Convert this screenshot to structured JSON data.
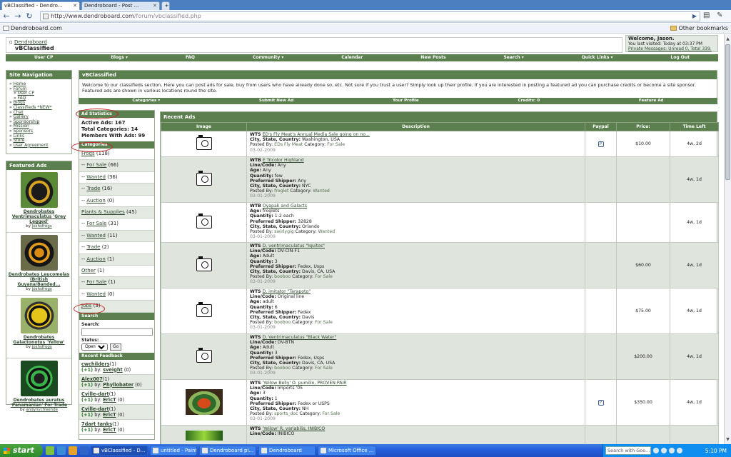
{
  "browser": {
    "tabs": [
      {
        "label": "vBClassified - Dendro...",
        "active": true
      },
      {
        "label": "Dendroboard - Post ...",
        "active": false
      }
    ],
    "url_host": "http://www.dendroboard.com",
    "url_path": "/forum/vbclassified.php",
    "bookmark": "Dendroboard.com",
    "other_bookmarks": "Other bookmarks"
  },
  "page": {
    "breadcrumb_root": "Dendroboard",
    "breadcrumb_current": "vBClassified",
    "welcome": {
      "title": "Welcome, Jason.",
      "last_visited": "You last visited: Today at 03:37 PM",
      "private_messages": "Private Messages: Unread 0, Total 339."
    },
    "navbar": [
      "User CP",
      "Blogs ▾",
      "FAQ",
      "Community ▾",
      "Calendar",
      "New Posts",
      "Search ▾",
      "Quick Links ▾",
      "Log Out"
    ]
  },
  "sidebar": {
    "site_nav_title": "Site Navigation",
    "site_nav_items": [
      {
        "label": "Home",
        "sub": false
      },
      {
        "label": "Forum",
        "sub": false
      },
      {
        "label": "User CP",
        "sub": true
      },
      {
        "label": "FAQ",
        "sub": true
      },
      {
        "label": "Blogs",
        "sub": false
      },
      {
        "label": "Classifieds *NEW*",
        "sub": false
      },
      {
        "label": "Chat",
        "sub": false
      },
      {
        "label": "Gallery",
        "sub": false
      },
      {
        "label": "Sponsorship",
        "sub": false
      },
      {
        "label": "Mission",
        "sub": false
      },
      {
        "label": "Sponsors",
        "sub": false
      },
      {
        "label": "Links",
        "sub": false
      },
      {
        "label": "Store",
        "sub": false
      },
      {
        "label": "User Agreement",
        "sub": false
      }
    ],
    "featured_title": "Featured Ads",
    "featured_ads": [
      {
        "title": "Dendrobates Ventrimaculatus 'Grey Legged'",
        "by": "joshsfrogs"
      },
      {
        "title": "Dendrobates Leucomelas (British Guyana/Banded...",
        "by": "joshsfrogs"
      },
      {
        "title": "Dendrobates Galactonotus 'Yellow'",
        "by": "joshsfrogs"
      },
      {
        "title": "Dendrobates auratus 'Panamanian' For Trade",
        "by": "andynycfreende"
      }
    ]
  },
  "main": {
    "title": "vBClassified",
    "intro": "Welcome to our classifieds section. Here you can post ads for sale, buy from users who have already done so, etc. Not sure if you trust a user? Simply look up their profile. If you are interested in posting a featured ad you can purchase credits or become a site sponsor. Featured ads are shown in various locations round the site.",
    "subnav": [
      "Categories ▾",
      "Submit New Ad",
      "Your Profile",
      "Credits: 0",
      "Feature Ad"
    ]
  },
  "stats": {
    "title": "Ad Statistics",
    "active_ads": "Active Ads: 167",
    "total_categories": "Total Categories: 14",
    "members_with_ads": "Members With Ads: 99"
  },
  "categories": {
    "title": "Categories",
    "items": [
      {
        "prefix": "",
        "label": "Frogs",
        "count": "(118)"
      },
      {
        "prefix": "-- ",
        "label": "For Sale",
        "count": "(66)"
      },
      {
        "prefix": "-- ",
        "label": "Wanted",
        "count": "(36)"
      },
      {
        "prefix": "-- ",
        "label": "Trade",
        "count": "(16)"
      },
      {
        "prefix": "-- ",
        "label": "Auction",
        "count": "(0)"
      },
      {
        "prefix": "",
        "label": "Plants & Supplies",
        "count": "(45)"
      },
      {
        "prefix": "-- ",
        "label": "For Sale",
        "count": "(31)"
      },
      {
        "prefix": "-- ",
        "label": "Wanted",
        "count": "(11)"
      },
      {
        "prefix": "-- ",
        "label": "Trade",
        "count": "(2)"
      },
      {
        "prefix": "-- ",
        "label": "Auction",
        "count": "(1)"
      },
      {
        "prefix": "",
        "label": "Other",
        "count": "(1)"
      },
      {
        "prefix": "-- ",
        "label": "For Sale",
        "count": "(1)"
      },
      {
        "prefix": "-- ",
        "label": "Wanted",
        "count": "(0)"
      },
      {
        "prefix": "",
        "label": "Jobs",
        "count": "(3)"
      }
    ]
  },
  "search": {
    "title": "Search",
    "search_label": "Search:",
    "status_label": "Status:",
    "status_value": "Open",
    "go_label": "Go"
  },
  "feedback": {
    "title": "Recent Feedback",
    "items": [
      {
        "user": "cwchilders",
        "n": "(1)",
        "score": "(+1)",
        "by": "sveight",
        "c": "(0)"
      },
      {
        "user": "Alex007",
        "n": "(1)",
        "score": "(+1)",
        "by": "Phyllobater",
        "c": "(0)"
      },
      {
        "user": "Cville-dart",
        "n": "(1)",
        "score": "(+1)",
        "by": "EricT",
        "c": "(0)"
      },
      {
        "user": "Cville-dart",
        "n": "(1)",
        "score": "(+1)",
        "by": "EricT",
        "c": "(0)"
      },
      {
        "user": "7dart tanks",
        "n": "(1)",
        "score": "(+1)",
        "by": "EricT",
        "c": "(0)"
      }
    ]
  },
  "recent_ads": {
    "title": "Recent Ads",
    "columns": [
      "Image",
      "Description",
      "Paypal",
      "Price:",
      "Time Left"
    ],
    "rows": [
      {
        "image": "camera",
        "type": "WTS",
        "title": "ED's Fly Meat's Annual Media Sale going on no...",
        "fields": [
          [
            "City, State, Country:",
            "Washington, USA"
          ]
        ],
        "posted_by": "EDs Fly Meat",
        "category": "For Sale",
        "date": "03-02-2009",
        "paypal": true,
        "price": "$10.00",
        "time_left": "4w, 2d"
      },
      {
        "image": "camera",
        "type": "WTB",
        "title": "E Tricolor Highland",
        "fields": [
          [
            "Line/Code:",
            "Any"
          ],
          [
            "Age:",
            "Any"
          ],
          [
            "Quantity:",
            "few"
          ],
          [
            "Preferred Shipper:",
            "Any"
          ],
          [
            "City, State, Country:",
            "NYC"
          ]
        ],
        "posted_by": "froglet",
        "category": "Wanted",
        "date": "03-01-2009",
        "paypal": false,
        "price": "",
        "time_left": "4w, 1d"
      },
      {
        "image": "camera",
        "type": "WTB",
        "title": "Oyapak and Galacts",
        "fields": [
          [
            "Age:",
            "froglets"
          ],
          [
            "Quantity:",
            "1-2 each"
          ],
          [
            "Preferred Shipper:",
            "32828"
          ],
          [
            "City, State, Country:",
            "Orlando"
          ]
        ],
        "posted_by": "swirlygig",
        "category": "Wanted",
        "date": "03-01-2009",
        "paypal": false,
        "price": "",
        "time_left": "4w, 1d"
      },
      {
        "image": "camera",
        "type": "WTS",
        "title": "D. ventrimaculatus \"Iquitos\"",
        "fields": [
          [
            "Line/Code:",
            "DV-CIN-F1"
          ],
          [
            "Age:",
            "Adult"
          ],
          [
            "Quantity:",
            "3"
          ],
          [
            "Preferred Shipper:",
            "Fedex, Usps"
          ],
          [
            "City, State, Country:",
            "Davis, CA, USA"
          ]
        ],
        "posted_by": "booboo",
        "category": "For Sale",
        "date": "03-01-2009",
        "paypal": false,
        "price": "$60.00",
        "time_left": "4w, 1d"
      },
      {
        "image": "camera",
        "type": "WTS",
        "title": "D. imitator \"Tarapoto\"",
        "fields": [
          [
            "Line/Code:",
            "Original line"
          ],
          [
            "Age:",
            "adult"
          ],
          [
            "Quantity:",
            "6"
          ],
          [
            "Preferred Shipper:",
            "Fedex"
          ],
          [
            "City, State, Country:",
            "Davis"
          ]
        ],
        "posted_by": "booboo",
        "category": "For Sale",
        "date": "03-01-2009",
        "paypal": false,
        "price": "$75.00",
        "time_left": "4w, 1d"
      },
      {
        "image": "camera",
        "type": "WTS",
        "title": "D. Ventrimaculatus \"Black Water\"",
        "fields": [
          [
            "Line/Code:",
            "DV-BTN"
          ],
          [
            "Age:",
            "Adult"
          ],
          [
            "Quantity:",
            "3"
          ],
          [
            "Preferred Shipper:",
            "Fedex, Usps"
          ],
          [
            "City, State, Country:",
            "Davis, CA, USA"
          ]
        ],
        "posted_by": "booboo",
        "category": "For Sale",
        "date": "03-01-2009",
        "paypal": false,
        "price": "$200.00",
        "time_left": "4w, 1d"
      },
      {
        "image": "photo",
        "type": "WTS",
        "title": "'Yellow Belly' O. pumilio, PROVEN PAIR",
        "fields": [
          [
            "Line/Code:",
            "Imports '05"
          ],
          [
            "Age:",
            "3"
          ],
          [
            "Quantity:",
            "1"
          ],
          [
            "Preferred Shipper:",
            "Fedex or USPS"
          ],
          [
            "City, State, Country:",
            "NH"
          ]
        ],
        "posted_by": "sports_doc",
        "category": "For Sale",
        "date": "03-01-2009",
        "paypal": true,
        "price": "$350.00",
        "time_left": "4w, 1d"
      },
      {
        "image": "photo2",
        "type": "WTS",
        "title": "'Yellow' R. variabilis, INIBICO",
        "fields": [
          [
            "Line/Code:",
            "INIBICO"
          ]
        ],
        "posted_by": "",
        "category": "",
        "date": "",
        "paypal": false,
        "price": "",
        "time_left": ""
      }
    ]
  },
  "taskbar": {
    "start": "start",
    "buttons": [
      {
        "label": "vBClassified - D...",
        "active": true
      },
      {
        "label": "untitled - Paint",
        "active": false
      },
      {
        "label": "Dendroboard pi...",
        "active": false
      },
      {
        "label": "Dendroboard",
        "active": false
      },
      {
        "label": "Microsoft Office ...",
        "active": false
      }
    ],
    "search_placeholder": "Search with Goo...",
    "clock": "5:10 PM"
  }
}
